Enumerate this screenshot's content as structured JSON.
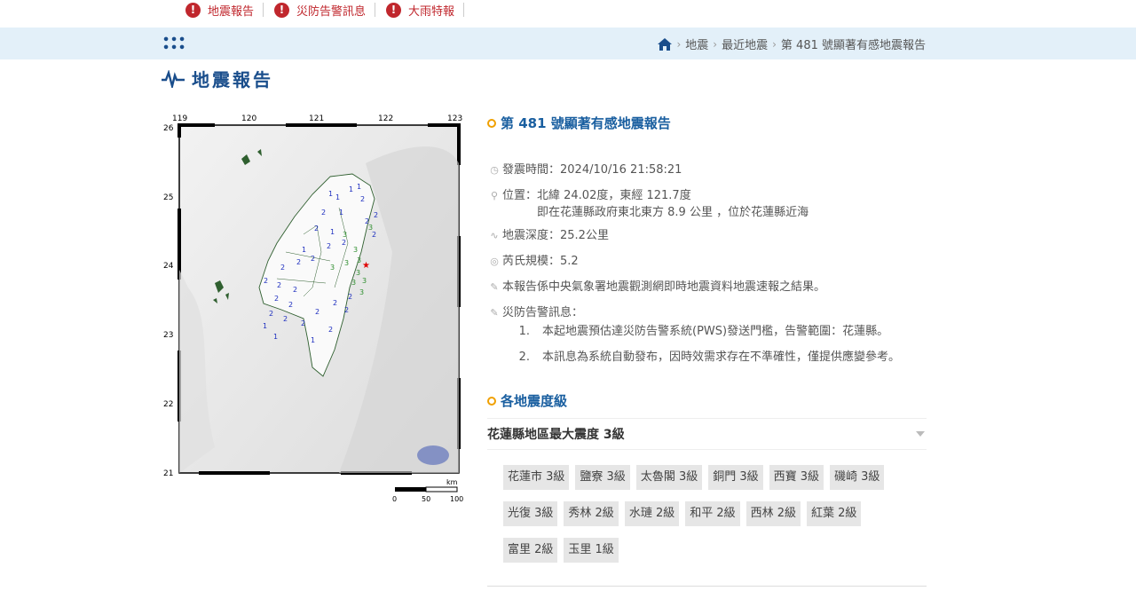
{
  "alerts": [
    {
      "label": "地震報告"
    },
    {
      "label": "災防告警訊息"
    },
    {
      "label": "大雨特報"
    }
  ],
  "breadcrumb": [
    "地震",
    "最近地震",
    "第 481 號顯著有感地震報告"
  ],
  "page_title": "地震報告",
  "report": {
    "heading": "第 481 號顯著有感地震報告",
    "time": "發震時間：2024/10/16 21:58:21",
    "location_line1": "位置：北緯 24.02度，東經 121.7度",
    "location_line2": "即在花蓮縣政府東北東方 8.9 公里 ，位於花蓮縣近海",
    "depth": "地震深度：25.2公里",
    "magnitude": "芮氏規模：5.2",
    "note": "本報告係中央氣象署地震觀測網即時地震資料地震速報之結果。",
    "pws_label": "災防告警訊息：",
    "pws_items": [
      {
        "n": "1.",
        "text": "本起地震預估達災防告警系統(PWS)發送門檻，告警範圍：花蓮縣。"
      },
      {
        "n": "2.",
        "text": "本訊息為系統自動發布，因時效需求存在不準確性，僅提供應變參考。"
      }
    ]
  },
  "intensity": {
    "heading": "各地震度級",
    "max_label": "花蓮縣地區最大震度 3級",
    "stations": [
      "花蓮市 3級",
      "鹽寮 3級",
      "太魯閣 3級",
      "銅門 3級",
      "西寶 3級",
      "磯崎 3級",
      "光復 3級",
      "秀林 2級",
      "水璉 2級",
      "和平 2級",
      "西林 2級",
      "紅葉 2級",
      "富里 2級",
      "玉里 1級"
    ]
  },
  "map": {
    "lon_labels": [
      "119",
      "120",
      "121",
      "122",
      "123"
    ],
    "lat_labels": [
      "26",
      "25",
      "24",
      "23",
      "22",
      "21"
    ],
    "scale_unit": "km",
    "scale_labels": [
      "0",
      "50",
      "100"
    ]
  },
  "colors": {
    "brand": "#1a4e8c",
    "alert": "#c0272d",
    "accent": "#f0a000",
    "crumb_bg": "#e3f0f9"
  }
}
